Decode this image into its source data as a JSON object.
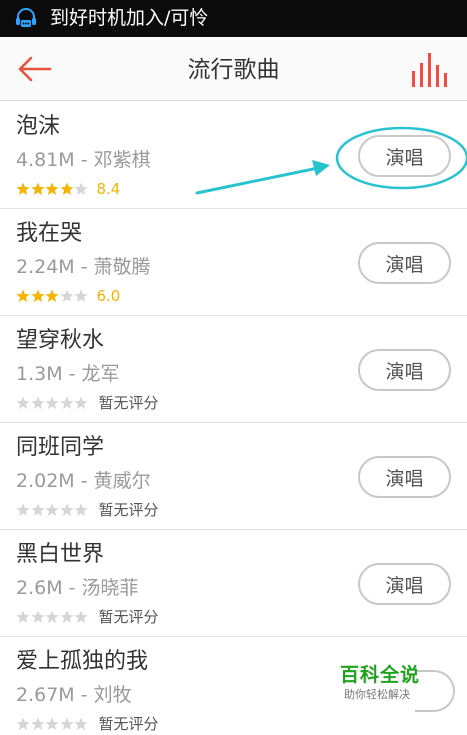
{
  "status_bar": {
    "icon": "headset-notification-icon",
    "text": "到好时机加入/可怜"
  },
  "header": {
    "back_icon": "arrow-left-icon",
    "title": "流行歌曲",
    "ranking_icon": "bar-chart-icon",
    "accent_color": "#e8523f"
  },
  "songs": [
    {
      "name": "泡沫",
      "size": "4.81M",
      "singer": "邓紫棋",
      "meta": "4.81M - 邓紫棋",
      "stars": 4,
      "score": "8.4",
      "button": "演唱"
    },
    {
      "name": "我在哭",
      "size": "2.24M",
      "singer": "萧敬腾",
      "meta": "2.24M - 萧敬腾",
      "stars": 3,
      "score": "6.0",
      "button": "演唱"
    },
    {
      "name": "望穿秋水",
      "size": "1.3M",
      "singer": "龙军",
      "meta": "1.3M - 龙军",
      "stars": 0,
      "no_rating": "暂无评分",
      "button": "演唱"
    },
    {
      "name": "同班同学",
      "size": "2.02M",
      "singer": "黄威尔",
      "meta": "2.02M - 黄威尔",
      "stars": 0,
      "no_rating": "暂无评分",
      "button": "演唱"
    },
    {
      "name": "黑白世界",
      "size": "2.6M",
      "singer": "汤晓菲",
      "meta": "2.6M - 汤晓菲",
      "stars": 0,
      "no_rating": "暂无评分",
      "button": "演唱"
    },
    {
      "name": "爱上孤独的我",
      "size": "2.67M",
      "singer": "刘牧",
      "meta": "2.67M - 刘牧",
      "stars": 0,
      "no_rating": "暂无评分",
      "button": ""
    }
  ],
  "colors": {
    "star_filled": "#f5b400",
    "star_empty": "#d6d6d6",
    "annotation": "#28c3cf"
  },
  "watermark": {
    "title": "百科全说",
    "subtitle": "助你轻松解决"
  }
}
